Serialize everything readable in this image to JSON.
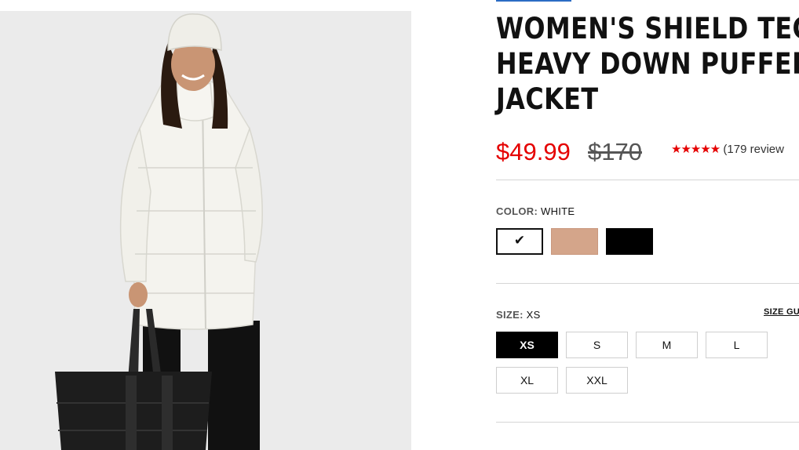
{
  "product": {
    "title_lines": [
      "WOMEN'S SHIELD TECH",
      "HEAVY DOWN PUFFER",
      "JACKET"
    ],
    "sale_price": "$49.99",
    "original_price": "$170",
    "rating_stars": "★★★★★",
    "review_text": "(179 review"
  },
  "color": {
    "label": "COLOR:",
    "selected": "WHITE",
    "swatches": [
      {
        "name": "white",
        "hex": "#ffffff",
        "selected": true
      },
      {
        "name": "tan",
        "hex": "#d4a58a",
        "selected": false
      },
      {
        "name": "black",
        "hex": "#000000",
        "selected": false
      }
    ],
    "check_icon": "✔"
  },
  "size": {
    "label": "SIZE:",
    "selected": "XS",
    "guide_link": "SIZE GU",
    "options": [
      "XS",
      "S",
      "M",
      "L",
      "XL",
      "XXL"
    ]
  },
  "colors": {
    "sale": "#e50000",
    "image_bg": "#ebebeb"
  }
}
